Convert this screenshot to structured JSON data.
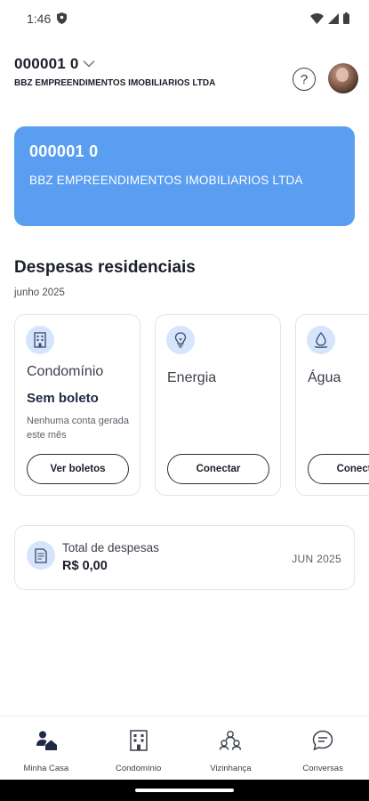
{
  "status_bar": {
    "time": "1:46"
  },
  "header": {
    "account_number": "000001 0",
    "account_name": "BBZ EMPREENDIMENTOS IMOBILIARIOS LTDA"
  },
  "card": {
    "number": "000001 0",
    "name": "BBZ EMPREENDIMENTOS IMOBILIARIOS LTDA",
    "color": "#5a9ef2"
  },
  "expenses": {
    "title": "Despesas residenciais",
    "month": "junho 2025",
    "items": [
      {
        "icon": "building-icon",
        "title": "Condomínio",
        "status": "Sem boleto",
        "note": "Nenhuma conta gerada este mês",
        "button": "Ver boletos"
      },
      {
        "icon": "lightbulb-icon",
        "title": "Energia",
        "button": "Conectar"
      },
      {
        "icon": "water-drop-icon",
        "title": "Água",
        "button": "Conectar"
      }
    ]
  },
  "total": {
    "label": "Total de despesas",
    "value": "R$ 0,00",
    "month": "JUN 2025"
  },
  "nav": {
    "items": [
      {
        "label": "Minha Casa",
        "icon": "house-person-icon"
      },
      {
        "label": "Condomínio",
        "icon": "building-icon"
      },
      {
        "label": "Vizinhança",
        "icon": "community-icon"
      },
      {
        "label": "Conversas",
        "icon": "chat-icon"
      }
    ]
  }
}
